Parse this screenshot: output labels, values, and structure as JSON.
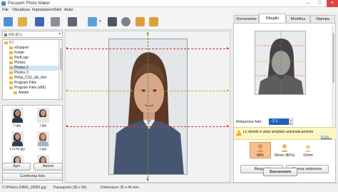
{
  "window": {
    "title": "Passport Photo Maker"
  },
  "menu": [
    "File",
    "Visualizza",
    "Impostazioni",
    "Skin",
    "Aiuto"
  ],
  "toolbar": {
    "icons": [
      "open-icon",
      "folder-icon",
      "save-icon",
      "print-icon",
      "camera-icon",
      "effects-icon",
      "document-icon",
      "settings-icon",
      "film-icon",
      "paint-icon"
    ]
  },
  "drive": {
    "label": "OS (C:)"
  },
  "tree": {
    "items": [
      "C:\\",
      "eSupport",
      "Folder",
      "PerfLogs",
      "Photos",
      "Photos 2",
      "Photos 3",
      "PhSp_CS2_UE_Ret",
      "Program Files",
      "Program Files (x86)",
      "Adobe"
    ]
  },
  "thumbnails": [
    {
      "name": "0.jpg"
    },
    {
      "name": "1.jpg"
    },
    {
      "name": "1 (170).jpg"
    },
    {
      "name": "2.jpg"
    },
    {
      "name": ""
    },
    {
      "name": ""
    }
  ],
  "left_buttons": {
    "open": "Apri",
    "actions": "Azioni",
    "compare": "Confronta foto"
  },
  "tabs": [
    "Documento",
    "Ritaglio",
    "Modifica",
    "Stampa"
  ],
  "active_tab": "Ritaglio",
  "rotation": {
    "label": "Rotazione foto:",
    "value": "-2.1"
  },
  "notice": {
    "text": "Lo sfondo è stato ampliato automaticamente",
    "link": "Di più..."
  },
  "size_options": [
    {
      "label": "88%"
    },
    {
      "label": "36mm (80%)"
    },
    {
      "label": "10mm"
    }
  ],
  "panel_buttons": {
    "requirements": "Requisiti",
    "new_selection": "Nuova selezione",
    "next": "Successivo"
  },
  "status": {
    "path": "C:\\Photos 2\\IMG_26981.jpg",
    "format": "Passaporto (35 x 45)",
    "dimensions": "Dimensioni: 35 x 45 mm"
  },
  "colors": {
    "accent": "#1b63bb",
    "guide_red": "#d9302a",
    "guide_green": "#4a9e3a",
    "highlight": "#f6c08a"
  }
}
